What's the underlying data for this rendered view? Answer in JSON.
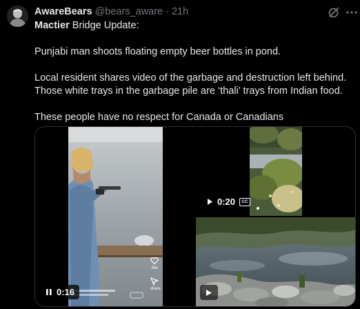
{
  "tweet": {
    "display_name": "AwareBears",
    "handle": "@bears_aware",
    "separator": "·",
    "time": "21h",
    "lead_bold": "Mactier",
    "lead_rest": " Bridge Update:",
    "line_2": "Punjabi man shoots floating empty beer bottles in pond.",
    "line_3": "Local resident shares video of the garbage and destruction left behind.",
    "line_4": "Those white trays in the garbage pile are ‘thali’ trays from Indian food.",
    "line_5": "These people have no respect for Canada or Canadians"
  },
  "media": {
    "video_1": {
      "time": "0:16",
      "icons": [
        "pause-icon"
      ],
      "like_label": "like",
      "share_label": "share"
    },
    "video_2": {
      "time": "0:20",
      "icons": [
        "play-icon",
        "closed-captions-icon"
      ],
      "cc_label": "CC"
    },
    "video_3": {
      "icons": [
        "play-icon"
      ]
    }
  },
  "icons": {
    "avatar": "avatar-portrait",
    "grok": "grok-icon",
    "more": "more-options-icon"
  },
  "colors": {
    "background": "#000000",
    "text_primary": "#e7e9ea",
    "text_secondary": "#71767b",
    "border": "#2f3336"
  }
}
